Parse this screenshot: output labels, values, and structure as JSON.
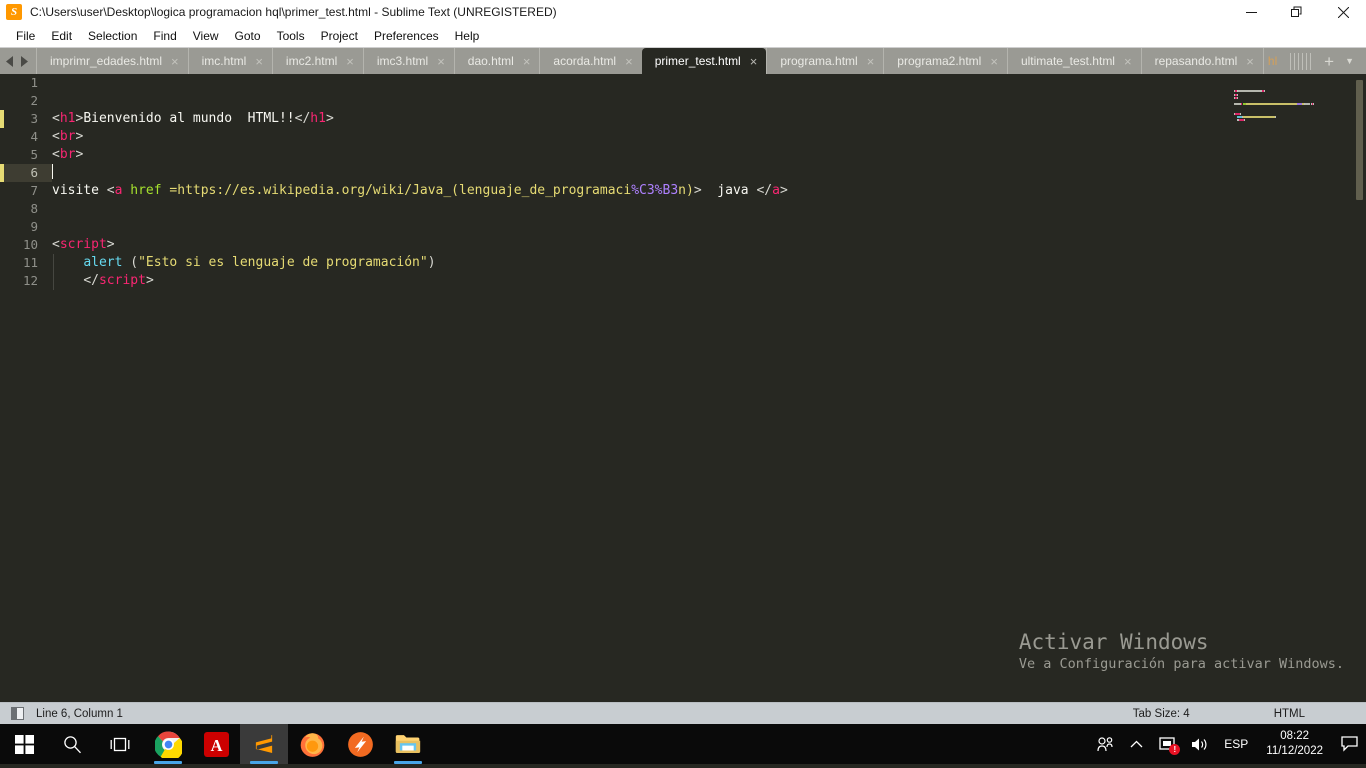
{
  "window": {
    "title": "C:\\Users\\user\\Desktop\\logica programacion hql\\primer_test.html - Sublime Text (UNREGISTERED)",
    "logo_glyph": "S",
    "controls": {
      "minimize": "minimize-icon",
      "maximize": "restore-icon",
      "close": "close-icon"
    }
  },
  "menubar": {
    "items": [
      {
        "label": "File"
      },
      {
        "label": "Edit"
      },
      {
        "label": "Selection"
      },
      {
        "label": "Find"
      },
      {
        "label": "View"
      },
      {
        "label": "Goto"
      },
      {
        "label": "Tools"
      },
      {
        "label": "Project"
      },
      {
        "label": "Preferences"
      },
      {
        "label": "Help"
      }
    ]
  },
  "tabbar": {
    "scroll_left": "chevron-left-icon",
    "scroll_right": "chevron-right-icon",
    "close_glyph": "×",
    "new_tab_label": "+",
    "tab_menu_label": "▼",
    "tabs": [
      {
        "label": "imprimr_edades.html",
        "active": false
      },
      {
        "label": "imc.html",
        "active": false
      },
      {
        "label": "imc2.html",
        "active": false
      },
      {
        "label": "imc3.html",
        "active": false
      },
      {
        "label": "dao.html",
        "active": false
      },
      {
        "label": "acorda.html",
        "active": false
      },
      {
        "label": "primer_test.html",
        "active": true
      },
      {
        "label": "programa.html",
        "active": false
      },
      {
        "label": "programa2.html",
        "active": false
      },
      {
        "label": "ultimate_test.html",
        "active": false
      },
      {
        "label": "repasando.html",
        "active": false
      },
      {
        "label": "hl",
        "active": false,
        "truncated": true
      }
    ]
  },
  "editor": {
    "active_line": 6,
    "lines": [
      {
        "n": 1,
        "tokens": []
      },
      {
        "n": 2,
        "tokens": []
      },
      {
        "n": 3,
        "tokens": [
          {
            "t": "punc",
            "v": "<"
          },
          {
            "t": "tag",
            "v": "h1"
          },
          {
            "t": "punc",
            "v": ">"
          },
          {
            "t": "txt",
            "v": "Bienvenido al mundo  HTML!!"
          },
          {
            "t": "punc",
            "v": "</"
          },
          {
            "t": "tag",
            "v": "h1"
          },
          {
            "t": "punc",
            "v": ">"
          }
        ]
      },
      {
        "n": 4,
        "tokens": [
          {
            "t": "punc",
            "v": "<"
          },
          {
            "t": "tag",
            "v": "br"
          },
          {
            "t": "punc",
            "v": ">"
          }
        ]
      },
      {
        "n": 5,
        "tokens": [
          {
            "t": "punc",
            "v": "<"
          },
          {
            "t": "tag",
            "v": "br"
          },
          {
            "t": "punc",
            "v": ">"
          }
        ]
      },
      {
        "n": 6,
        "tokens": [],
        "cursor": true
      },
      {
        "n": 7,
        "tokens": [
          {
            "t": "txt",
            "v": "visite "
          },
          {
            "t": "punc",
            "v": "<"
          },
          {
            "t": "tag",
            "v": "a"
          },
          {
            "t": "txt",
            "v": " "
          },
          {
            "t": "attr",
            "v": "href"
          },
          {
            "t": "url",
            "v": " =https://es.wikipedia.org/wiki/Java_(lenguaje_de_programaci"
          },
          {
            "t": "esc",
            "v": "%C3%B3"
          },
          {
            "t": "url",
            "v": "n)"
          },
          {
            "t": "punc",
            "v": ">"
          },
          {
            "t": "txt",
            "v": "  java "
          },
          {
            "t": "punc",
            "v": "</"
          },
          {
            "t": "tag",
            "v": "a"
          },
          {
            "t": "punc",
            "v": ">"
          }
        ]
      },
      {
        "n": 8,
        "tokens": []
      },
      {
        "n": 9,
        "tokens": []
      },
      {
        "n": 10,
        "tokens": [
          {
            "t": "punc",
            "v": "<"
          },
          {
            "t": "tag",
            "v": "script"
          },
          {
            "t": "punc",
            "v": ">"
          }
        ]
      },
      {
        "n": 11,
        "tokens": [
          {
            "t": "txt",
            "v": "    "
          },
          {
            "t": "kw",
            "v": "alert"
          },
          {
            "t": "punc",
            "v": " ("
          },
          {
            "t": "str",
            "v": "\"Esto si es lenguaje de programación\""
          },
          {
            "t": "punc",
            "v": ")"
          }
        ]
      },
      {
        "n": 12,
        "tokens": [
          {
            "t": "txt",
            "v": "    "
          },
          {
            "t": "punc",
            "v": "</"
          },
          {
            "t": "tag",
            "v": "script"
          },
          {
            "t": "punc",
            "v": ">"
          }
        ]
      }
    ]
  },
  "watermark": {
    "title": "Activar Windows",
    "subtitle": "Ve a Configuración para activar Windows."
  },
  "statusbar": {
    "position": "Line 6, Column 1",
    "tab_size": "Tab Size: 4",
    "syntax": "HTML"
  },
  "taskbar": {
    "items": [
      {
        "name": "start-button",
        "icon": "windows-logo-icon"
      },
      {
        "name": "search-button",
        "icon": "search-icon"
      },
      {
        "name": "task-view-button",
        "icon": "task-view-icon"
      },
      {
        "name": "taskbar-chrome",
        "icon": "chrome-icon"
      },
      {
        "name": "taskbar-acrobat",
        "icon": "acrobat-icon"
      },
      {
        "name": "taskbar-sublime-text",
        "icon": "sublime-text-icon"
      },
      {
        "name": "taskbar-firefox",
        "icon": "firefox-icon"
      },
      {
        "name": "taskbar-app-orange",
        "icon": "orange-app-icon"
      },
      {
        "name": "taskbar-file-explorer",
        "icon": "folder-icon"
      }
    ],
    "tray": {
      "people": "people-icon",
      "show_hidden": "chevron-up-icon",
      "network": "network-icon",
      "volume": "volume-icon",
      "language": "ESP",
      "time": "08:22",
      "date": "11/12/2022",
      "action_center": "action-center-icon"
    }
  },
  "colors": {
    "editor_bg": "#272822",
    "tag": "#f92672",
    "attr": "#a6e22e",
    "string": "#e6db74",
    "keyword": "#66d9ef",
    "escape": "#ae81ff",
    "active_line_gutter": "#3e3d32",
    "accent": "#48a5e8"
  }
}
